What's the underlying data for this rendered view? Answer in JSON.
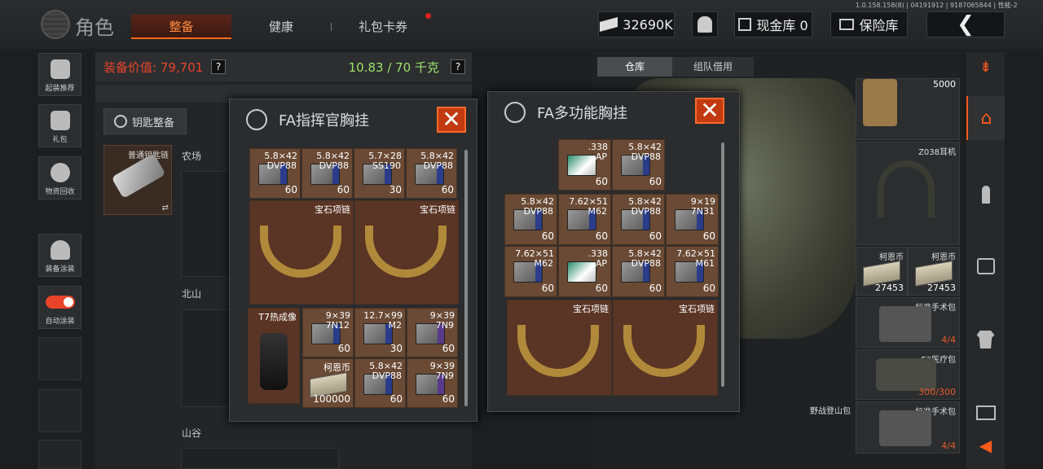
{
  "header": {
    "title": "角色",
    "tabs": [
      {
        "label": "整备",
        "active": true
      },
      {
        "label": "健康",
        "active": false
      },
      {
        "label": "礼包卡券",
        "active": false
      }
    ],
    "version": "1.0.158.158(8) | 04191912 | 9187065844 | 性能-2",
    "currency": "32690K",
    "cash_storage": "现金库 0",
    "safe_storage": "保险库"
  },
  "sidebar": [
    {
      "label": "起装推荐",
      "icon": "helmet-icon"
    },
    {
      "label": "礼包",
      "icon": "gift-icon"
    },
    {
      "label": "物资回收",
      "icon": "recycle-icon"
    },
    {
      "label": "装备涂装",
      "icon": "soldier-icon"
    },
    {
      "label": "自动涂装",
      "icon": "toggle-icon"
    }
  ],
  "value_bar": {
    "label": "装备价值: 79,701",
    "help": "?",
    "weight": "10.83 / 70 千克"
  },
  "key_button": "钥匙整备",
  "key_slot": {
    "name": "普通钥匙链"
  },
  "zones": [
    "农场",
    "北山",
    "山谷"
  ],
  "right_panel": {
    "tabs": [
      {
        "label": "仓库",
        "active": true
      },
      {
        "label": "组队借用",
        "active": false
      }
    ],
    "items": [
      {
        "name": "",
        "count": "5000"
      },
      {
        "name": "Z038耳机",
        "count": ""
      },
      {
        "name": "柯恩币",
        "count": "27453"
      },
      {
        "name": "柯恩币",
        "count": "27453"
      },
      {
        "name": "标准手术包",
        "count": "4/4"
      },
      {
        "name": "E3医疗包",
        "count": "300/300"
      },
      {
        "name": "标准手术包",
        "count": "4/4"
      },
      {
        "name": "野战登山包",
        "count": ""
      }
    ]
  },
  "popup_left": {
    "title": "FA指挥官胸挂",
    "ammo_row": [
      {
        "cal": "5.8×42",
        "type": "DVP88",
        "qty": "60",
        "color": "blue"
      },
      {
        "cal": "5.8×42",
        "type": "DVP88",
        "qty": "60",
        "color": "blue"
      },
      {
        "cal": "5.7×28",
        "type": "SS190",
        "qty": "30",
        "color": "blue"
      },
      {
        "cal": "5.8×42",
        "type": "DVP88",
        "qty": "60",
        "color": "blue"
      }
    ],
    "necklaces": [
      "宝石项链",
      "宝石项链"
    ],
    "scope": "T7热成像",
    "bottom_ammo": [
      {
        "cal": "9×39",
        "type": "7N12",
        "qty": "60",
        "color": "blue"
      },
      {
        "cal": "12.7×99",
        "type": "M2",
        "qty": "30",
        "color": "blue"
      },
      {
        "cal": "9×39",
        "type": "7N9",
        "qty": "60",
        "color": "purple"
      },
      {
        "cal": "柯恩币",
        "type": "",
        "qty": "100000",
        "color": "cash"
      },
      {
        "cal": "5.8×42",
        "type": "DVP88",
        "qty": "60",
        "color": "blue"
      },
      {
        "cal": "9×39",
        "type": "7N9",
        "qty": "60",
        "color": "purple"
      }
    ]
  },
  "popup_right": {
    "title": "FA多功能胸挂",
    "top_row": [
      {
        "cal": ".338",
        "type": "AP",
        "qty": "60",
        "color": "green"
      },
      {
        "cal": "5.8×42",
        "type": "DVP88",
        "qty": "60",
        "color": "blue"
      }
    ],
    "row2": [
      {
        "cal": "5.8×42",
        "type": "DVP88",
        "qty": "60",
        "color": "blue"
      },
      {
        "cal": "7.62×51",
        "type": "M62",
        "qty": "60",
        "color": "blue"
      },
      {
        "cal": "5.8×42",
        "type": "DVP88",
        "qty": "60",
        "color": "blue"
      },
      {
        "cal": "9×19",
        "type": "7N31",
        "qty": "60",
        "color": "blue"
      }
    ],
    "row3": [
      {
        "cal": "7.62×51",
        "type": "M62",
        "qty": "60",
        "color": "blue"
      },
      {
        "cal": ".338",
        "type": "AP",
        "qty": "60",
        "color": "green"
      },
      {
        "cal": "5.8×42",
        "type": "DVP88",
        "qty": "60",
        "color": "blue"
      },
      {
        "cal": "7.62×51",
        "type": "M61",
        "qty": "60",
        "color": "blue"
      }
    ],
    "necklaces": [
      "宝石项链",
      "宝石项链"
    ]
  }
}
